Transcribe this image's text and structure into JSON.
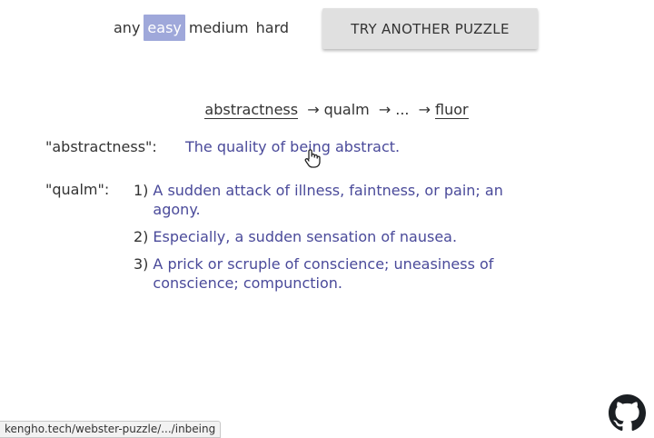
{
  "difficulty": {
    "options": [
      "any",
      "easy",
      "medium",
      "hard"
    ],
    "selected": "easy"
  },
  "try_button_label": "TRY ANOTHER PUZZLE",
  "chain": {
    "start": "abstractness",
    "arrow": "→",
    "middle": "qualm",
    "ellipsis": "...",
    "end": "fluor"
  },
  "definitions": [
    {
      "word": "\"abstractness\":",
      "text": "The quality of being abstract."
    },
    {
      "word": "\"qualm\":",
      "senses": [
        {
          "num": "1)",
          "text": "A sudden attack of illness, faintness, or pain; an agony."
        },
        {
          "num": "2)",
          "text": "Especially, a sudden sensation of nausea."
        },
        {
          "num": "3)",
          "text": "A prick or scruple of conscience; uneasiness of conscience; compunction."
        }
      ]
    }
  ],
  "status_bar": "kengho.tech/webster-puzzle/.../inbeing",
  "icons": {
    "github": "github-icon",
    "cursor": "hand-pointer-icon"
  },
  "colors": {
    "selected_bg": "#9fa8da",
    "definition_text": "#4a4a9a",
    "button_bg": "#e0e0e0"
  }
}
